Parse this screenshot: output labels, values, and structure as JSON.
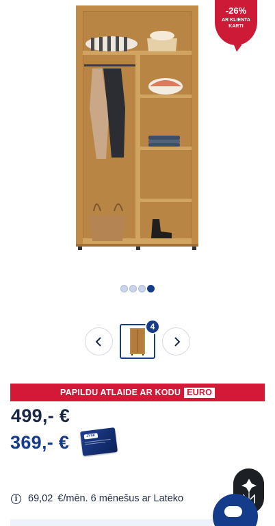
{
  "product": {
    "discount_badge": {
      "percent": "-26%",
      "subtitle": "AR KLIENTA KARTI"
    },
    "image_alt_icon": "wardrobe-image"
  },
  "carousel": {
    "dot_count": 4,
    "active_index": 3,
    "thumbnail_count": "4",
    "prev_icon": "chevron-left-icon",
    "next_icon": "chevron-right-icon"
  },
  "promo": {
    "text": "PAPILDU ATLAIDE AR KODU",
    "code": "EURO"
  },
  "prices": {
    "old": "499,-  €",
    "new": "369,- €",
    "club_card_logo": "JYSK"
  },
  "installment": {
    "amount": "69,02",
    "text": "€/mēn. 6 mēnešus ar Lateko"
  },
  "colors": {
    "brand_blue": "#143c8a",
    "promo_red": "#d41838",
    "wood": "#c89a52"
  }
}
